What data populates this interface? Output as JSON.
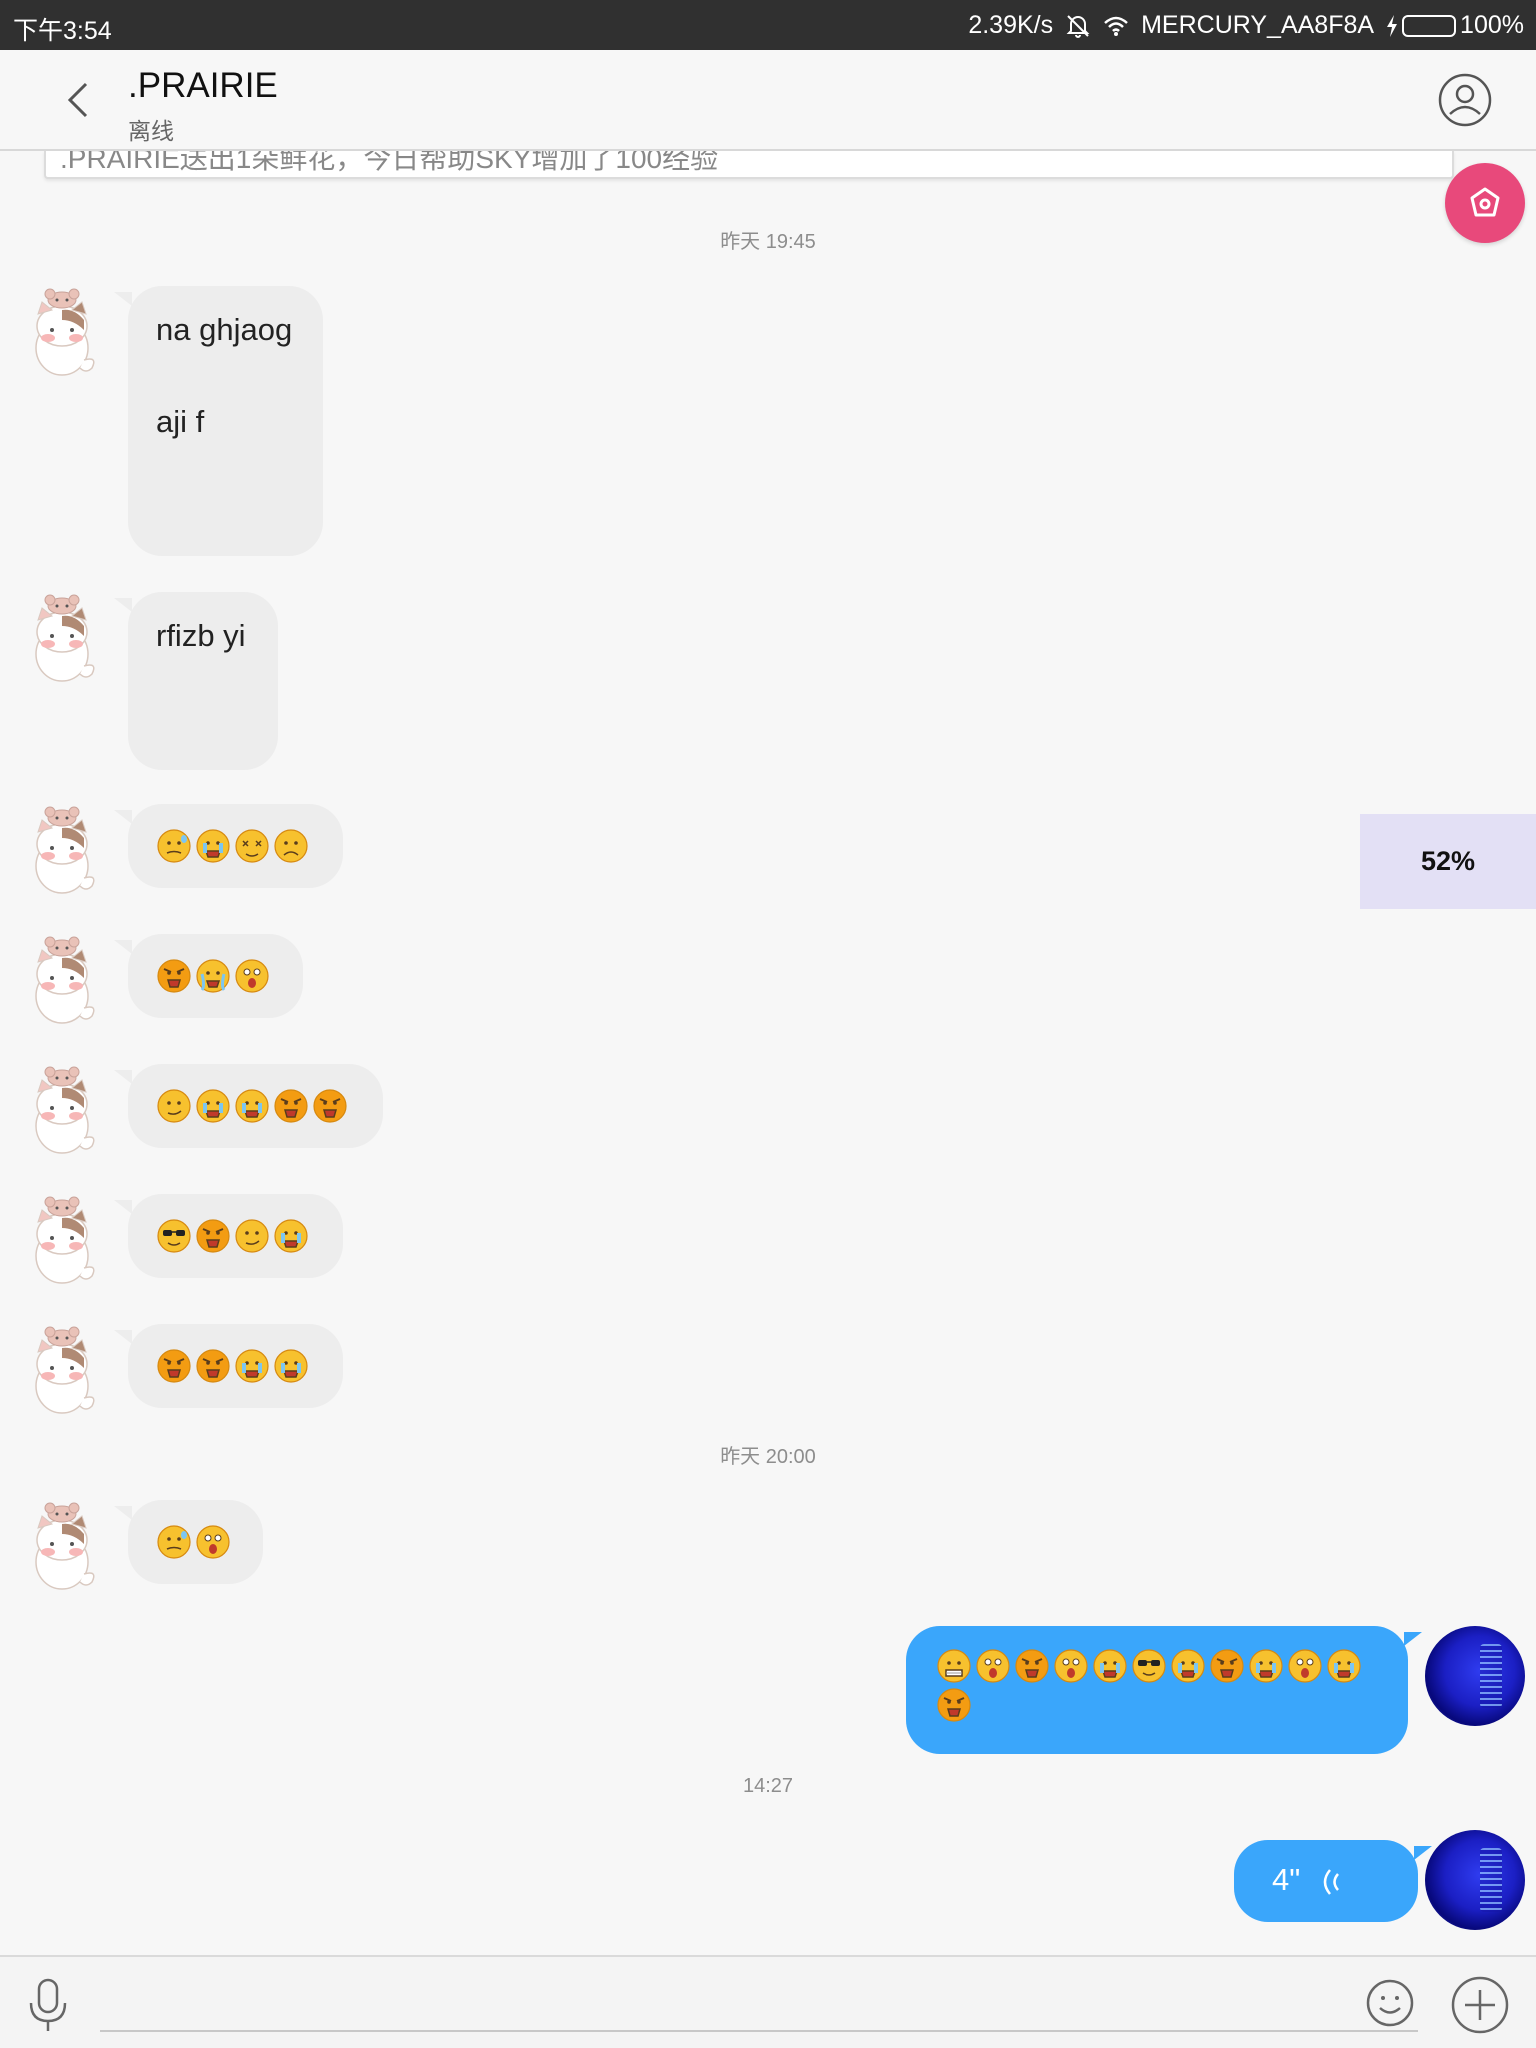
{
  "status_bar": {
    "time": "下午3:54",
    "net_speed": "2.39K/s",
    "wifi_name": "MERCURY_AA8F8A",
    "battery": "100%",
    "battery_level": 1.0
  },
  "header": {
    "title": ".PRAIRIE",
    "subtitle": "离线"
  },
  "pinned_notice": ".PRAIRIE送出1朵鲜花，今日帮助SKY增加了100经验",
  "timestamps": [
    "昨天 19:45",
    "昨天 20:00",
    "14:27"
  ],
  "messages": [
    {
      "from": "other",
      "lines": [
        "na ghjaog",
        "aji f"
      ]
    },
    {
      "from": "other",
      "lines": [
        "rfizb yi"
      ]
    },
    {
      "from": "other",
      "emojis": [
        "sweat-face",
        "crying-face",
        "dizzy-face",
        "worried-face"
      ]
    },
    {
      "from": "other",
      "emojis": [
        "angry-face",
        "sob-face",
        "shocked-face"
      ]
    },
    {
      "from": "other",
      "emojis": [
        "smirk-face",
        "crying-face",
        "crying-face",
        "angry-face",
        "angry-face"
      ]
    },
    {
      "from": "other",
      "emojis": [
        "sunglasses-face",
        "angry-face",
        "smirk-face",
        "crying-face"
      ]
    },
    {
      "from": "other",
      "emojis": [
        "angry-face",
        "angry-face",
        "crying-face",
        "crying-face"
      ]
    },
    {
      "from": "other",
      "emojis": [
        "sweat-face",
        "shocked-face"
      ]
    },
    {
      "from": "me",
      "emojis": [
        "grimace-face",
        "shocked-face",
        "angry-face",
        "shocked-face",
        "crying-face",
        "sunglasses-face",
        "crying-face",
        "angry-face",
        "crying-face",
        "shocked-face",
        "crying-face",
        "angry-face"
      ]
    },
    {
      "from": "me",
      "voice": "4\""
    }
  ],
  "percent_badge": "52%",
  "input": {
    "placeholder": ""
  },
  "colors": {
    "outgoing_bubble": "#3aa6fb",
    "incoming_bubble": "#ededed",
    "fab": "#e8497b"
  }
}
